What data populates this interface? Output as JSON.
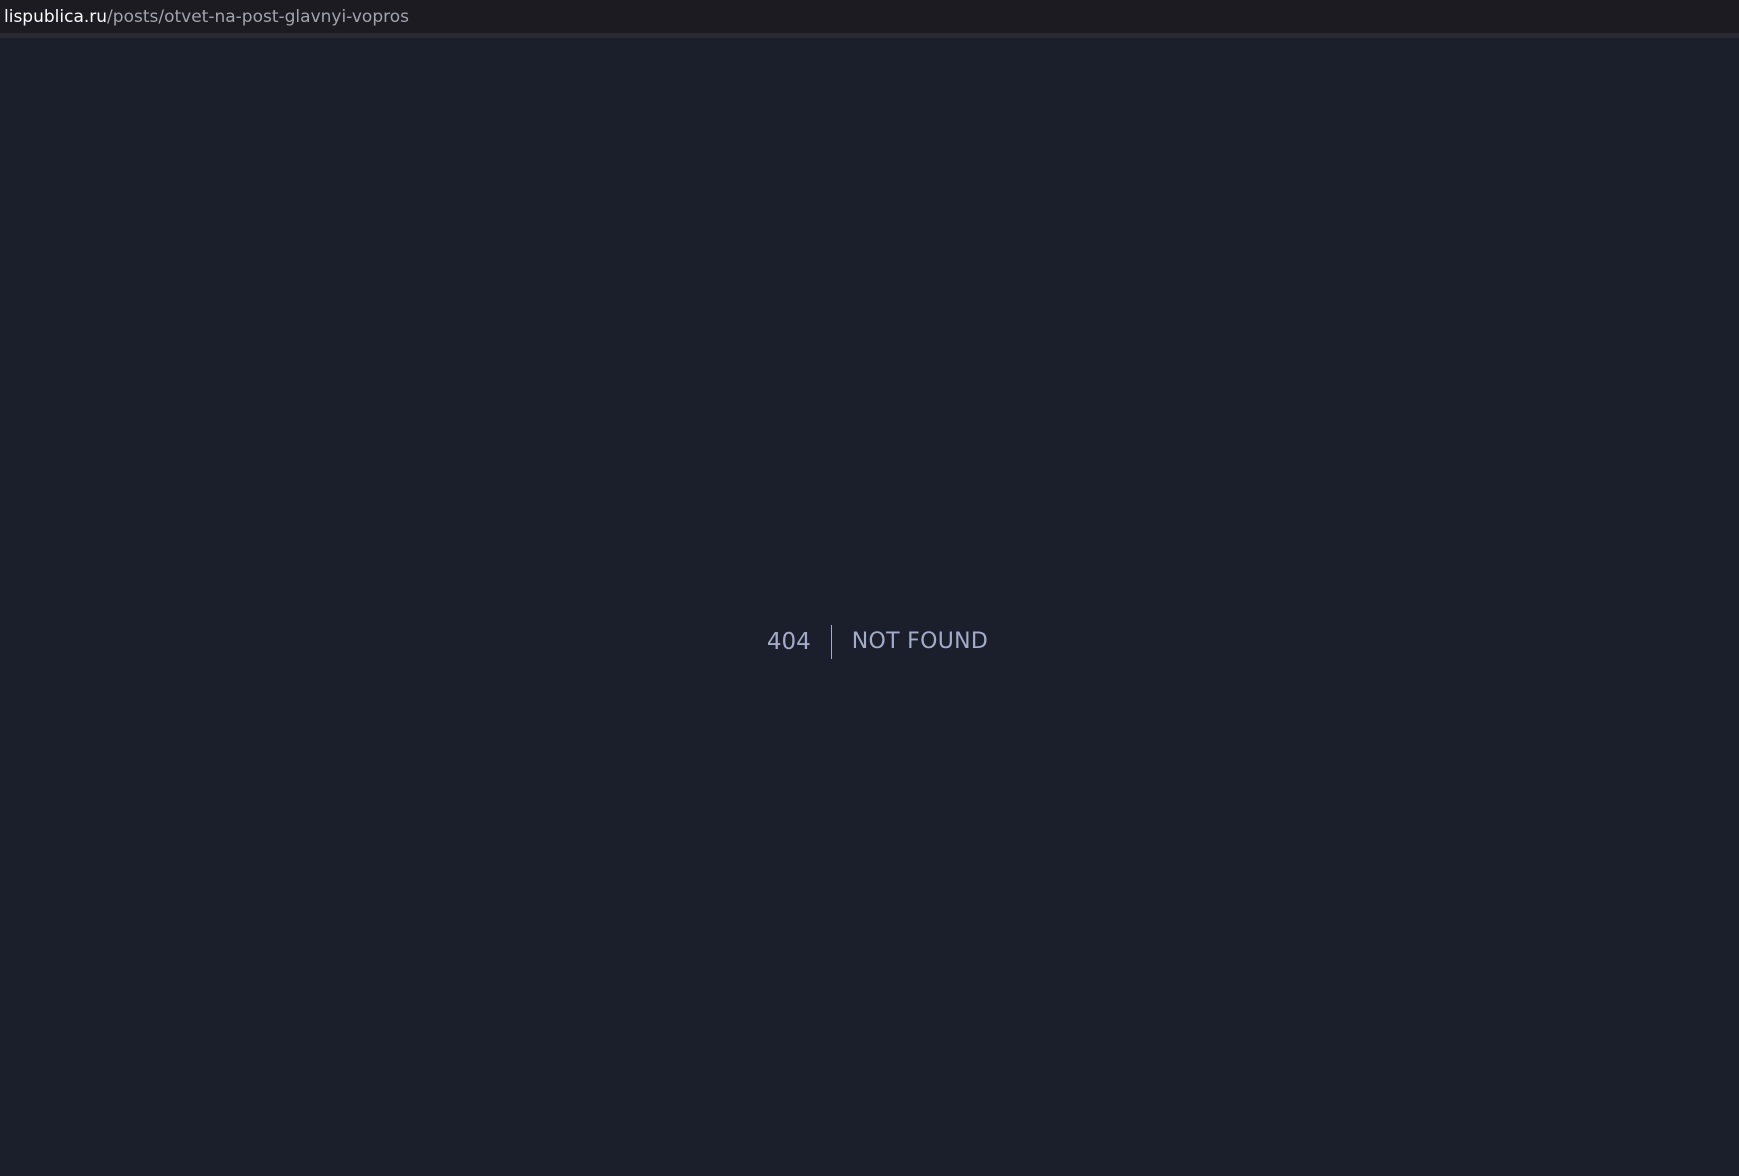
{
  "browser": {
    "url_domain": "lispublica.ru",
    "url_path": "/posts/otvet-na-post-glavnyi-vopros"
  },
  "error": {
    "code": "404",
    "message": "NOT FOUND"
  },
  "colors": {
    "background": "#1b1f2b",
    "text": "#a3abc8"
  }
}
